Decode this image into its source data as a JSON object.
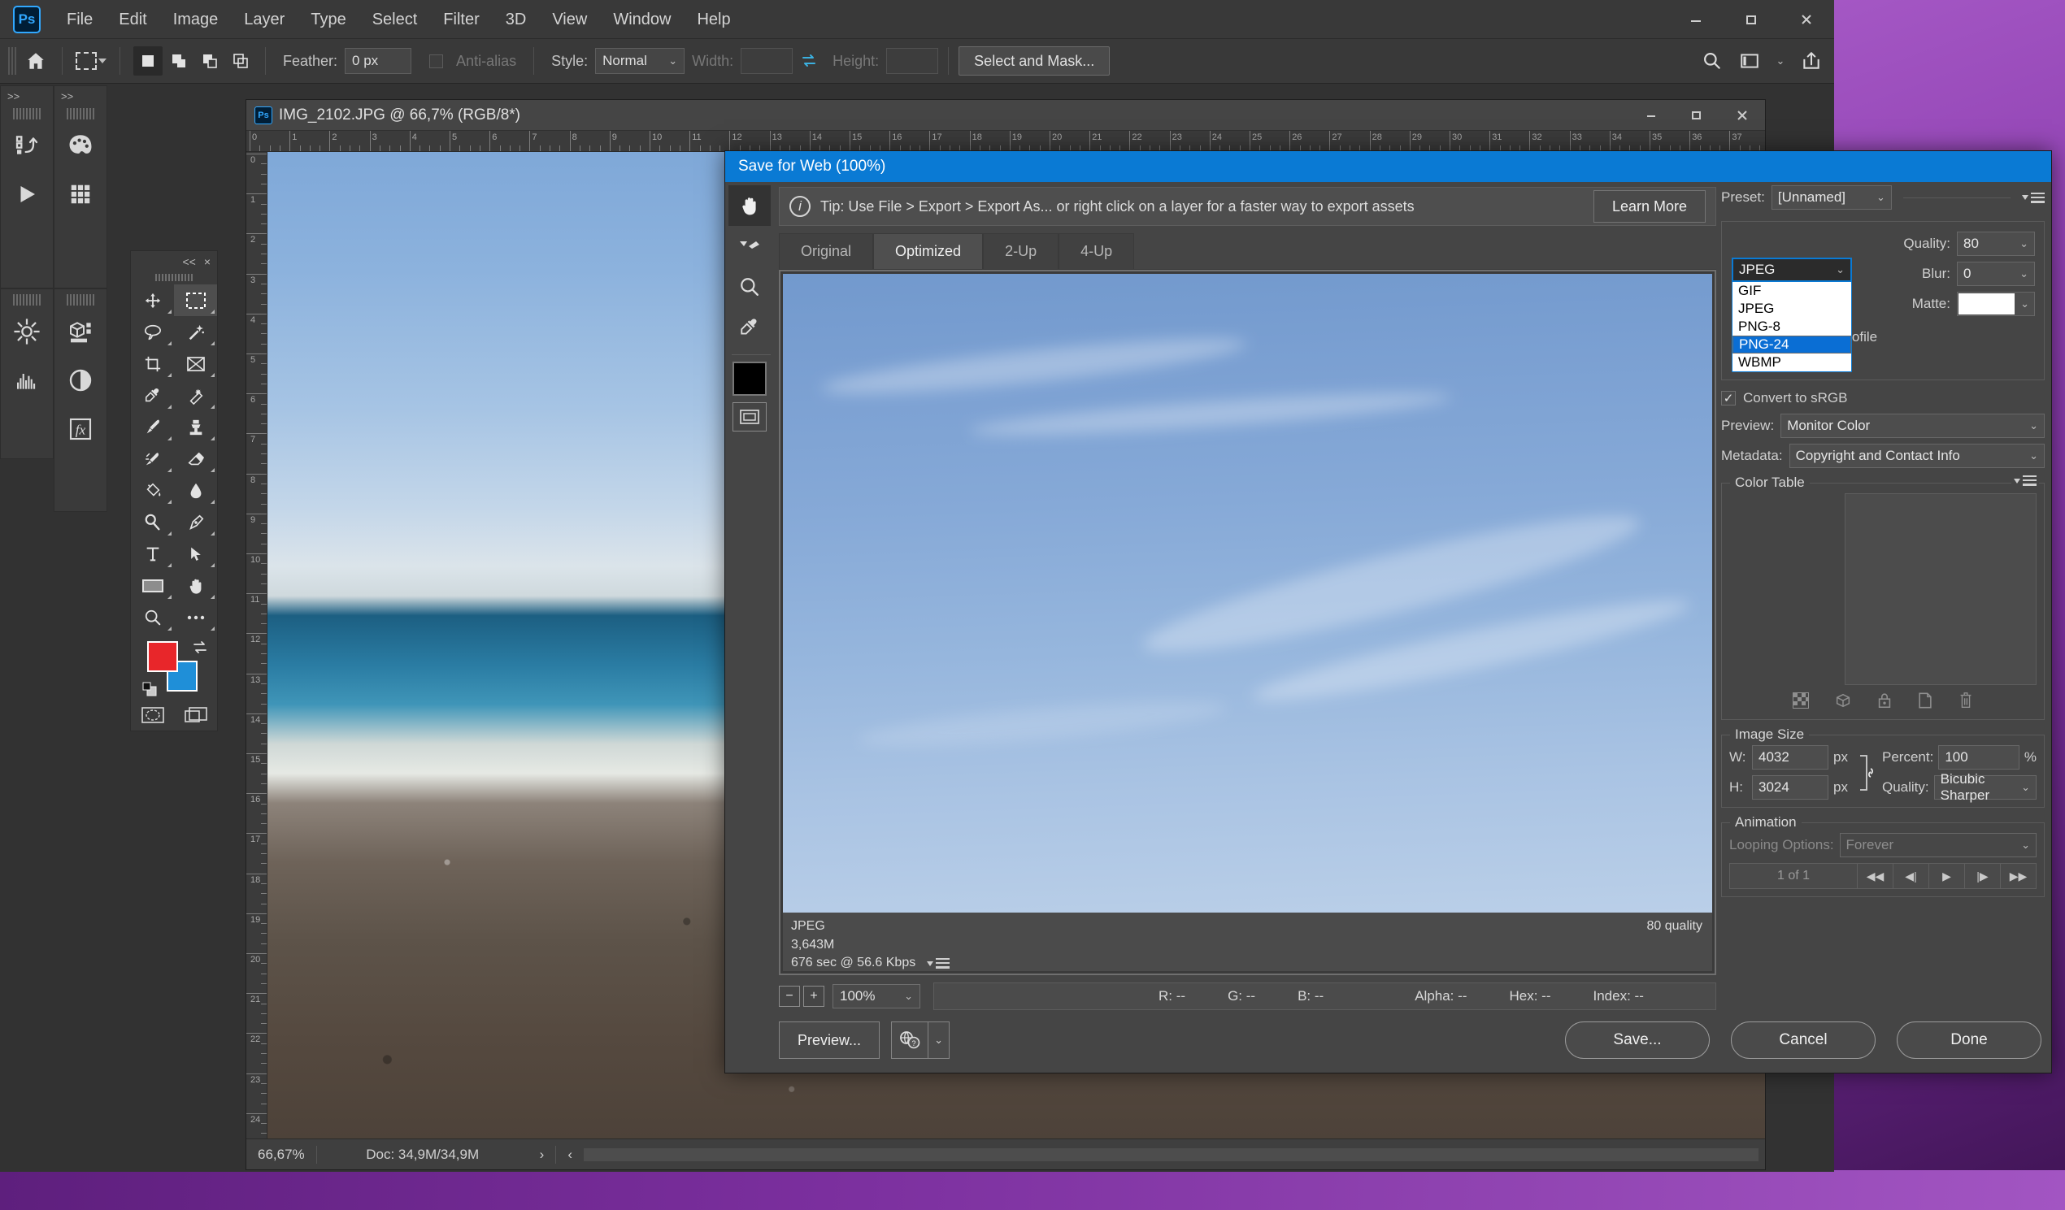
{
  "app": {
    "name": "Adobe Photoshop",
    "logo_text": "Ps",
    "accent_color": "#31a8ff",
    "title_dialog_color": "#0a7ad4"
  },
  "menubar": {
    "items": [
      "File",
      "Edit",
      "Image",
      "Layer",
      "Type",
      "Select",
      "Filter",
      "3D",
      "View",
      "Window",
      "Help"
    ],
    "window_controls": [
      "minimize",
      "maximize",
      "close"
    ]
  },
  "options_bar": {
    "home_icon": "home-icon",
    "tool_preset": "rectangular-marquee-icon",
    "selection_modes": [
      "new-selection",
      "add-to-selection",
      "subtract-from-selection",
      "intersect-with-selection"
    ],
    "feather_label": "Feather:",
    "feather_value": "0 px",
    "antialias_label": "Anti-alias",
    "style_label": "Style:",
    "style_value": "Normal",
    "width_label": "Width:",
    "width_value": "",
    "height_label": "Height:",
    "height_value": "",
    "select_and_mask": "Select and Mask...",
    "right_icons": [
      "search-icon",
      "workspace-icon",
      "chevron-down-icon",
      "share-icon"
    ]
  },
  "left_rails": {
    "collapse_left": ">>",
    "collapse_right": ">>",
    "icons": [
      "history-icon",
      "play-icon",
      "swatches-icon",
      "grid-icon",
      "adjustments-icon",
      "3d-icon",
      "histogram-icon",
      "contrast-icon",
      "fx-icon"
    ]
  },
  "toolbox": {
    "collapse": "<<",
    "close": "×",
    "tools": [
      "move-tool",
      "rectangular-marquee-tool",
      "lasso-tool",
      "magic-wand-tool",
      "crop-tool",
      "frame-tool",
      "eyedropper-tool",
      "healing-brush-tool",
      "brush-tool",
      "clone-stamp-tool",
      "history-brush-tool",
      "eraser-tool",
      "paint-bucket-tool",
      "blur-tool",
      "dodge-tool",
      "pen-tool",
      "type-tool",
      "path-selection-tool",
      "rectangle-tool",
      "hand-tool",
      "zoom-tool",
      "more-tools"
    ],
    "active_tool": "rectangular-marquee-tool",
    "foreground_color": "#e8262a",
    "background_color": "#1f8fd8",
    "bottom_icons": [
      "quick-mask-icon",
      "screen-mode-icon"
    ]
  },
  "document": {
    "logo_badge": "Ps",
    "title": "IMG_2102.JPG @ 66,7% (RGB/8*)",
    "window_controls": [
      "minimize",
      "maximize",
      "close"
    ],
    "ruler_h_ticks": [
      "0",
      "1",
      "2",
      "3",
      "4",
      "5",
      "6",
      "7",
      "8",
      "9",
      "10",
      "11",
      "12",
      "13",
      "14",
      "15",
      "16",
      "17",
      "18",
      "19",
      "20",
      "21",
      "22",
      "23",
      "24",
      "25",
      "26",
      "27",
      "28",
      "29",
      "30",
      "31",
      "32",
      "33",
      "34",
      "35",
      "36",
      "37"
    ],
    "ruler_v_ticks": [
      "0",
      "1",
      "2",
      "3",
      "4",
      "5",
      "6",
      "7",
      "8",
      "9",
      "10",
      "11",
      "12",
      "13",
      "14",
      "15",
      "16",
      "17",
      "18",
      "19",
      "20",
      "21",
      "22",
      "23",
      "24",
      "25"
    ],
    "status": {
      "zoom": "66,67%",
      "doc": "Doc: 34,9M/34,9M",
      "arrow_right": "›",
      "arrow_left": "‹"
    }
  },
  "save_for_web": {
    "title": "Save for Web (100%)",
    "tools": [
      "hand-tool",
      "slice-select-tool",
      "zoom-tool",
      "eyedropper-tool"
    ],
    "active_tool": "hand-tool",
    "eyedropper_color": "#000000",
    "toggle_slices_icon": "toggle-slices-icon",
    "tip": {
      "info_icon": "info-icon",
      "text": "Tip: Use File > Export > Export As...  or right click on a layer for a faster way to export assets",
      "learn_more": "Learn More"
    },
    "tabs": [
      {
        "label": "Original",
        "active": false
      },
      {
        "label": "Optimized",
        "active": true
      },
      {
        "label": "2-Up",
        "active": false
      },
      {
        "label": "4-Up",
        "active": false
      }
    ],
    "preview_info": {
      "format": "JPEG",
      "size": "3,643M",
      "download_time": "676 sec @ 56.6 Kbps",
      "quality_note": "80 quality",
      "menu_icon": "panel-menu-icon"
    },
    "zoom_bar": {
      "minus": "−",
      "plus": "+",
      "zoom_value": "100%",
      "readouts": [
        {
          "label": "R:",
          "value": "--"
        },
        {
          "label": "G:",
          "value": "--"
        },
        {
          "label": "B:",
          "value": "--"
        },
        {
          "label": "Alpha:",
          "value": "--"
        },
        {
          "label": "Hex:",
          "value": "--"
        },
        {
          "label": "Index:",
          "value": "--"
        }
      ]
    },
    "bottom": {
      "preview_button": "Preview...",
      "browser_icon": "browser-preview-icon",
      "browser_chevron": "chevron-down-icon",
      "save_button": "Save...",
      "cancel_button": "Cancel",
      "done_button": "Done"
    },
    "settings": {
      "preset_label": "Preset:",
      "preset_value": "[Unnamed]",
      "preset_menu_icon": "panel-menu-icon",
      "format_dropdown": {
        "selected": "JPEG",
        "open": true,
        "options": [
          "GIF",
          "JPEG",
          "PNG-8",
          "PNG-24",
          "WBMP"
        ],
        "highlighted": "PNG-24"
      },
      "quality_label": "Quality:",
      "quality_value": "80",
      "blur_label": "Blur:",
      "blur_value": "0",
      "matte_label": "Matte:",
      "matte_color": "#ffffff",
      "embed_color_profile_label": "Embed Color Profile",
      "embed_color_profile_checked": false,
      "convert_to_srgb_label": "Convert to sRGB",
      "convert_to_srgb_checked": true,
      "preview_label": "Preview:",
      "preview_value": "Monitor Color",
      "metadata_label": "Metadata:",
      "metadata_value": "Copyright and Contact Info",
      "color_table": {
        "title": "Color Table",
        "menu_icon": "panel-menu-icon",
        "tools": [
          "transparency-icon",
          "web-shift-icon",
          "lock-icon",
          "new-color-icon",
          "delete-icon"
        ]
      },
      "image_size": {
        "title": "Image Size",
        "w_label": "W:",
        "w_value": "4032",
        "w_unit": "px",
        "h_label": "H:",
        "h_value": "3024",
        "h_unit": "px",
        "link_icon": "link-icon",
        "percent_label": "Percent:",
        "percent_value": "100",
        "percent_unit": "%",
        "quality_label": "Quality:",
        "quality_value": "Bicubic Sharper"
      },
      "animation": {
        "title": "Animation",
        "looping_label": "Looping Options:",
        "looping_value": "Forever",
        "frame_count": "1 of 1",
        "buttons": [
          "first-frame",
          "previous-frame",
          "play",
          "next-frame",
          "last-frame"
        ]
      }
    }
  }
}
